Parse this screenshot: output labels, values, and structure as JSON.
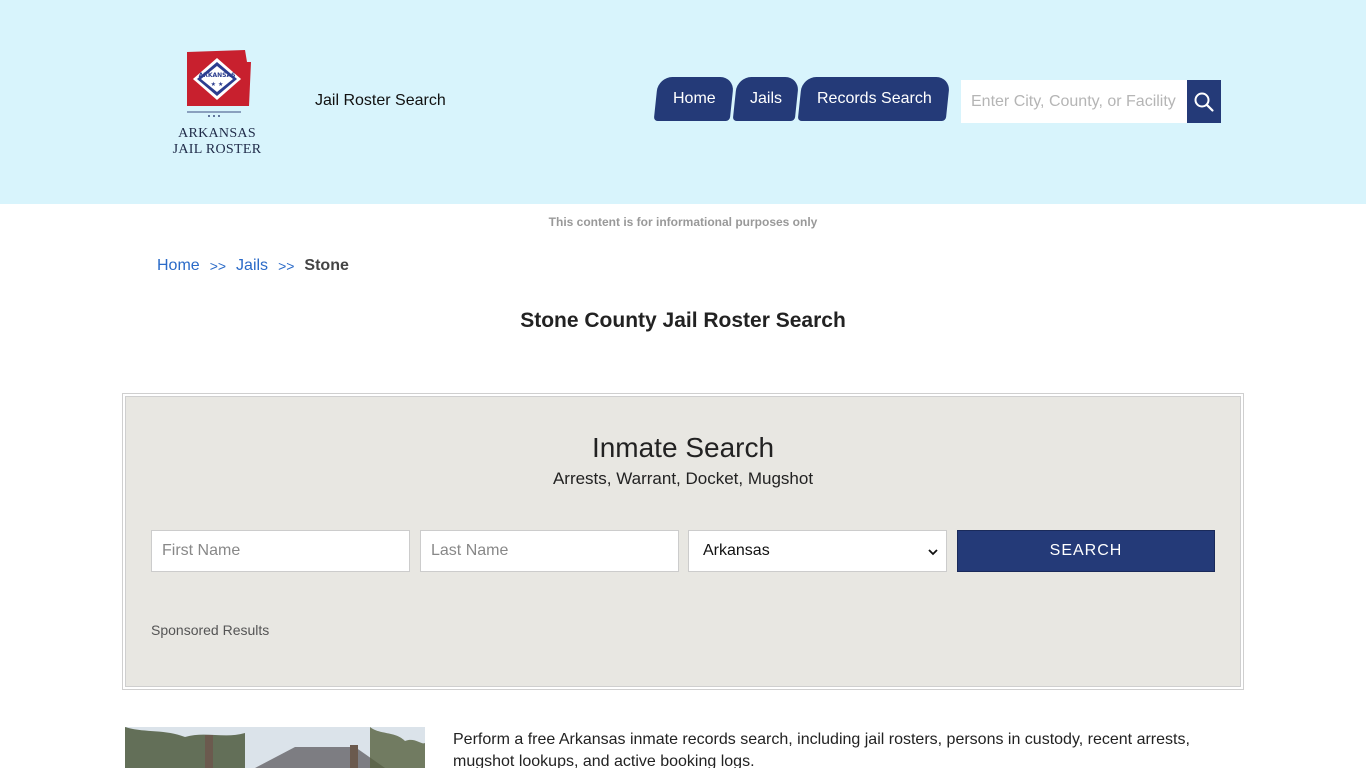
{
  "header": {
    "logo_line1": "ARKANSAS",
    "logo_line2": "JAIL ROSTER",
    "logo_badge_text": "ARKANSAS",
    "tagline": "Jail Roster Search",
    "nav": [
      {
        "label": "Home"
      },
      {
        "label": "Jails"
      },
      {
        "label": "Records Search"
      }
    ],
    "search": {
      "placeholder": "Enter City, County, or Facility",
      "value": ""
    },
    "icons": {
      "search": "search-icon"
    }
  },
  "disclaimer": "This content is for informational purposes only",
  "breadcrumb": {
    "items": [
      "Home",
      "Jails"
    ],
    "separator": ">>",
    "current": "Stone"
  },
  "page_title": "Stone County Jail Roster Search",
  "inmate_search": {
    "title": "Inmate Search",
    "subtitle": "Arrests, Warrant, Docket, Mugshot",
    "first_name_placeholder": "First Name",
    "last_name_placeholder": "Last Name",
    "state_selected": "Arkansas",
    "submit_label": "SEARCH",
    "sponsored": "Sponsored Results"
  },
  "intro": "Perform a free Arkansas inmate records search, including jail rosters, persons in custody, recent arrests, mugshot lookups, and active booking logs.",
  "colors": {
    "header_bg": "#d8f4fc",
    "accent": "#243a78",
    "link": "#2a6ac8",
    "panel_bg": "#e8e7e2"
  }
}
